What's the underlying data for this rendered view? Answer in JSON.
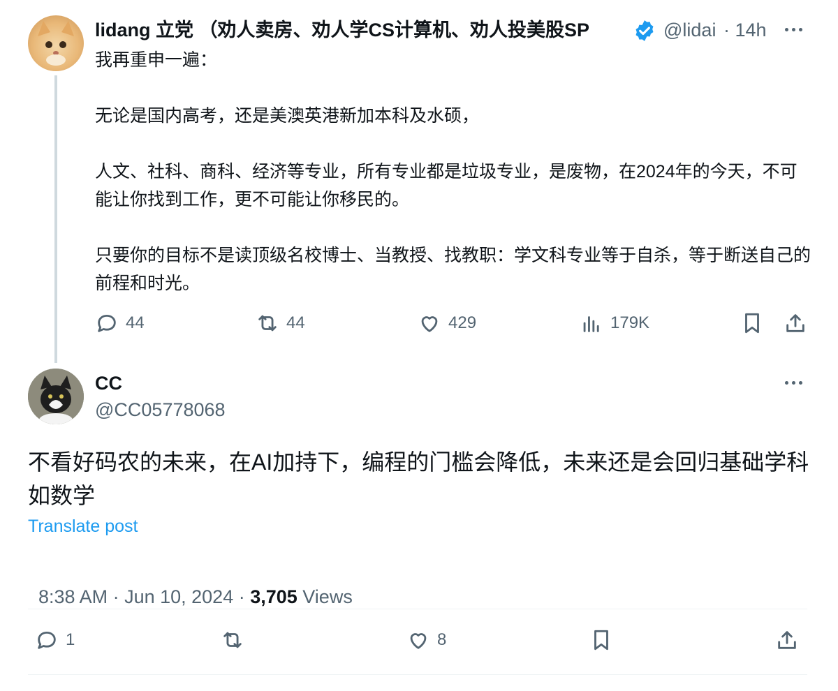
{
  "parent_tweet": {
    "author_name": "lidang 立党 （劝人卖房、劝人学CS计算机、劝人投美股SP",
    "verified": true,
    "handle": "@lidai",
    "time": "· 14h",
    "text": "我再重申一遍：\n\n无论是国内高考，还是美澳英港新加本科及水硕，\n\n人文、社科、商科、经济等专业，所有专业都是垃圾专业，是废物，在2024年的今天，不可能让你找到工作，更不可能让你移民的。\n\n只要你的目标不是读顶级名校博士、当教授、找教职：学文科专业等于自杀，等于断送自己的前程和时光。",
    "replies": "44",
    "reposts": "44",
    "likes": "429",
    "views": "179K"
  },
  "reply_tweet": {
    "author_name": "CC",
    "handle": "@CC05778068",
    "text": "不看好码农的未来，在AI加持下，编程的门槛会降低，未来还是会回归基础学科如数学",
    "translate_label": "Translate post",
    "timestamp": "8:38 AM · Jun 10, 2024 · ",
    "view_count": "3,705",
    "views_label": " Views",
    "replies": "1",
    "likes": "8"
  },
  "colors": {
    "link": "#1d9bf0",
    "muted": "#536471",
    "verified": "#1d9bf0",
    "thread_line": "#cfd9de"
  }
}
